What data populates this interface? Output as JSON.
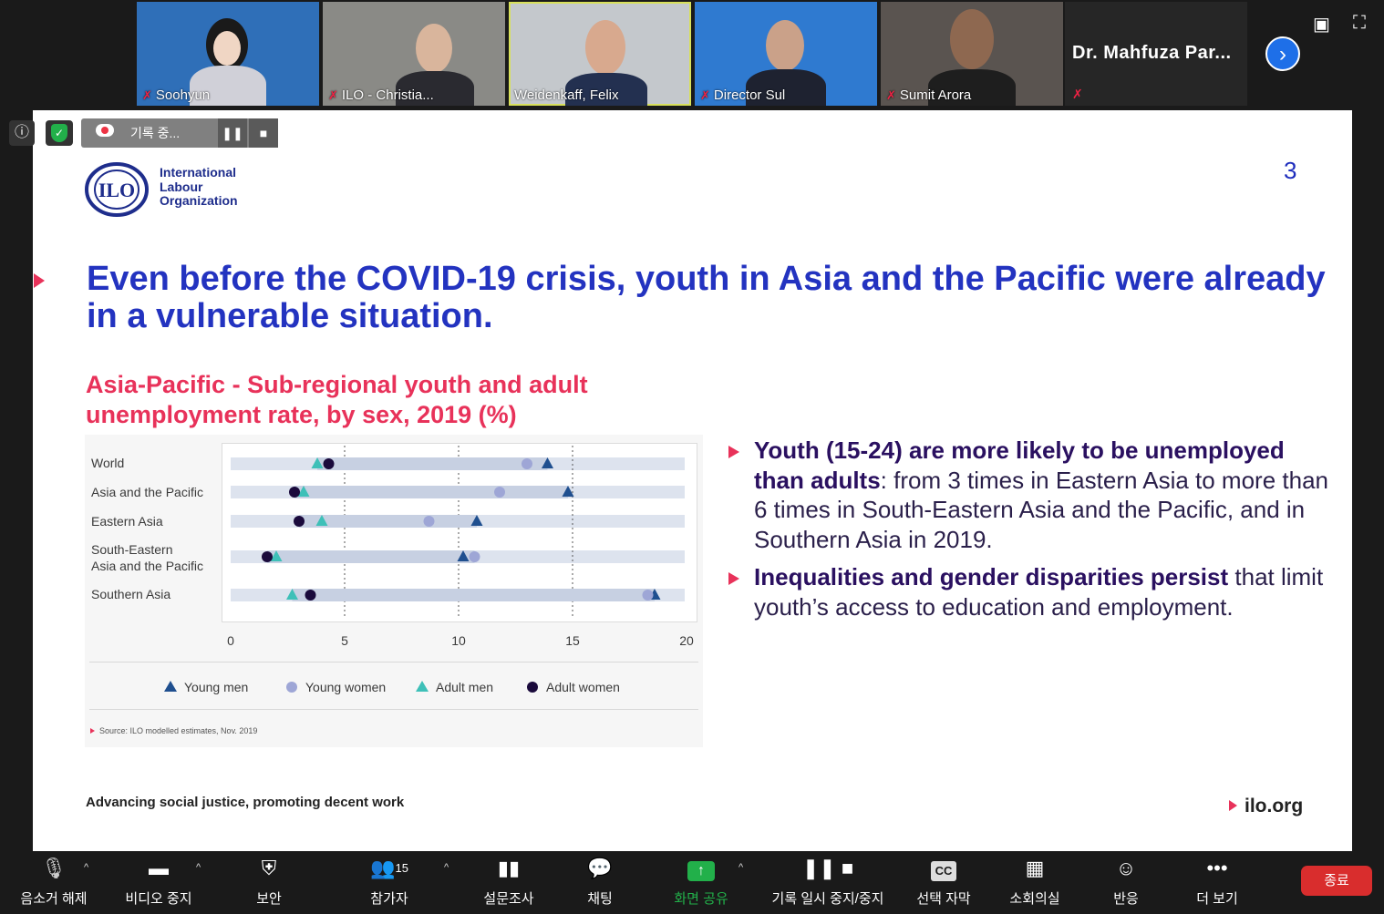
{
  "participants": [
    {
      "name": "Soohyun",
      "muted": true
    },
    {
      "name": "ILO - Christia...",
      "muted": true
    },
    {
      "name": "Weidenkaff, Felix",
      "muted": false,
      "active": true
    },
    {
      "name": "Director Sul",
      "muted": true
    },
    {
      "name": "Sumit Arora",
      "muted": true
    }
  ],
  "name_tile": {
    "name": "Dr. Mahfuza Par...",
    "muted": true
  },
  "recording": {
    "label": "기록 중..."
  },
  "slide": {
    "org_name": [
      "International",
      "Labour",
      "Organization"
    ],
    "logo_letters": "ILO",
    "page_number": "3",
    "title": "Even before the COVID-19 crisis, youth in Asia and the Pacific were already in a vulnerable situation.",
    "chart_title": "Asia-Pacific - Sub-regional youth and adult unemployment rate, by sex, 2019 (%)",
    "source": "Source: ILO modelled estimates, Nov. 2019",
    "bullets": [
      {
        "bold": "Youth (15-24) are more likely to be unemployed than adults",
        "rest": ": from 3 times in Eastern Asia to more than 6 times in South-Eastern Asia and the Pacific, and in Southern Asia in 2019."
      },
      {
        "bold": "Inequalities and gender disparities persist",
        "rest": " that limit youth’s access to education and employment."
      }
    ],
    "footer": "Advancing social justice, promoting decent work",
    "site": "ilo.org"
  },
  "chart_data": {
    "type": "scatter",
    "categories": [
      "World",
      "Asia and the Pacific",
      "Eastern Asia",
      "South-Eastern Asia and the Pacific",
      "Southern Asia"
    ],
    "category_lines": [
      [
        "World"
      ],
      [
        "Asia and the Pacific"
      ],
      [
        "Eastern Asia"
      ],
      [
        "South-Eastern",
        "Asia and the Pacific"
      ],
      [
        "Southern Asia"
      ]
    ],
    "series": [
      {
        "name": "Young men",
        "values": [
          13.9,
          14.8,
          10.8,
          10.2,
          18.6
        ],
        "color": "#1f4f8f",
        "marker": "triangle"
      },
      {
        "name": "Young women",
        "values": [
          13.0,
          11.8,
          8.7,
          10.7,
          18.3
        ],
        "color": "#9ea6d6",
        "marker": "circle"
      },
      {
        "name": "Adult men",
        "values": [
          3.8,
          3.2,
          4.0,
          2.0,
          2.7
        ],
        "color": "#3ec0b8",
        "marker": "triangle"
      },
      {
        "name": "Adult women",
        "values": [
          4.3,
          2.8,
          3.0,
          1.6,
          3.5
        ],
        "color": "#1a0a3c",
        "marker": "circle"
      }
    ],
    "xlim": [
      0,
      20
    ],
    "xticks": [
      "0",
      "5",
      "10",
      "15",
      "20"
    ],
    "grid": true,
    "legend_position": "bottom"
  },
  "toolbar": {
    "participant_count": "15",
    "items": [
      "음소거 해제",
      "비디오 중지",
      "보안",
      "참가자",
      "설문조사",
      "채팅",
      "화면 공유",
      "기록 일시 중지/중지",
      "선택 자막",
      "소회의실",
      "반응",
      "더 보기"
    ],
    "end_label": "종료"
  },
  "colors": {
    "slide_title": "#2333c0",
    "chart_title": "#e8325a",
    "accent": "#e8325a",
    "share": "#22b04a",
    "end": "#d92d2d"
  }
}
